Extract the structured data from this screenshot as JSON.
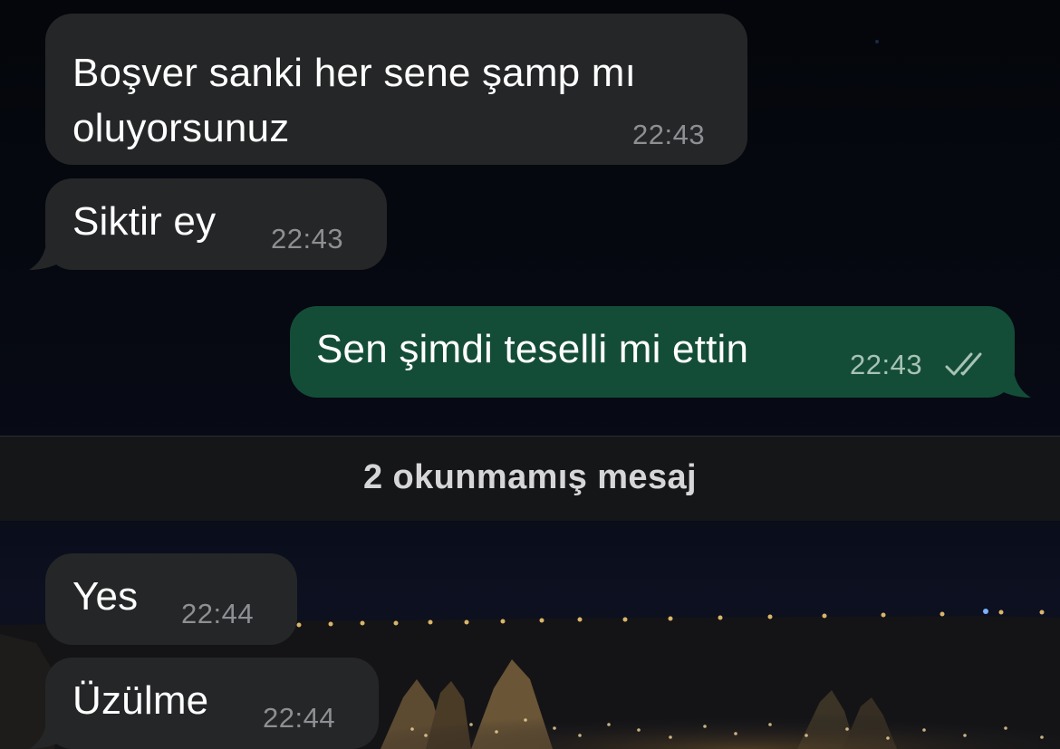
{
  "messages": [
    {
      "direction": "incoming",
      "lines": [
        "Boşver sanki her sene şamp mı",
        "oluyorsunuz"
      ],
      "time": "22:43"
    },
    {
      "direction": "incoming",
      "text": "Siktir ey",
      "time": "22:43"
    },
    {
      "direction": "outgoing",
      "text": "Sen şimdi teselli mi ettin",
      "time": "22:43",
      "status": "read"
    },
    {
      "direction": "incoming",
      "text": "Yes",
      "time": "22:44"
    },
    {
      "direction": "incoming",
      "text": "Üzülme",
      "time": "22:44"
    }
  ],
  "unread_divider": {
    "label": "2 okunmamış mesaj"
  },
  "colors": {
    "background": "#06080e",
    "incoming_bubble": "#252627",
    "outgoing_bubble": "#144d37",
    "text": "#ffffff",
    "timestamp": "#8e8f93",
    "read_ticks": "#a7c3b6",
    "divider_background": "#151618"
  },
  "icons": {
    "read_receipt": "double-check-icon"
  }
}
